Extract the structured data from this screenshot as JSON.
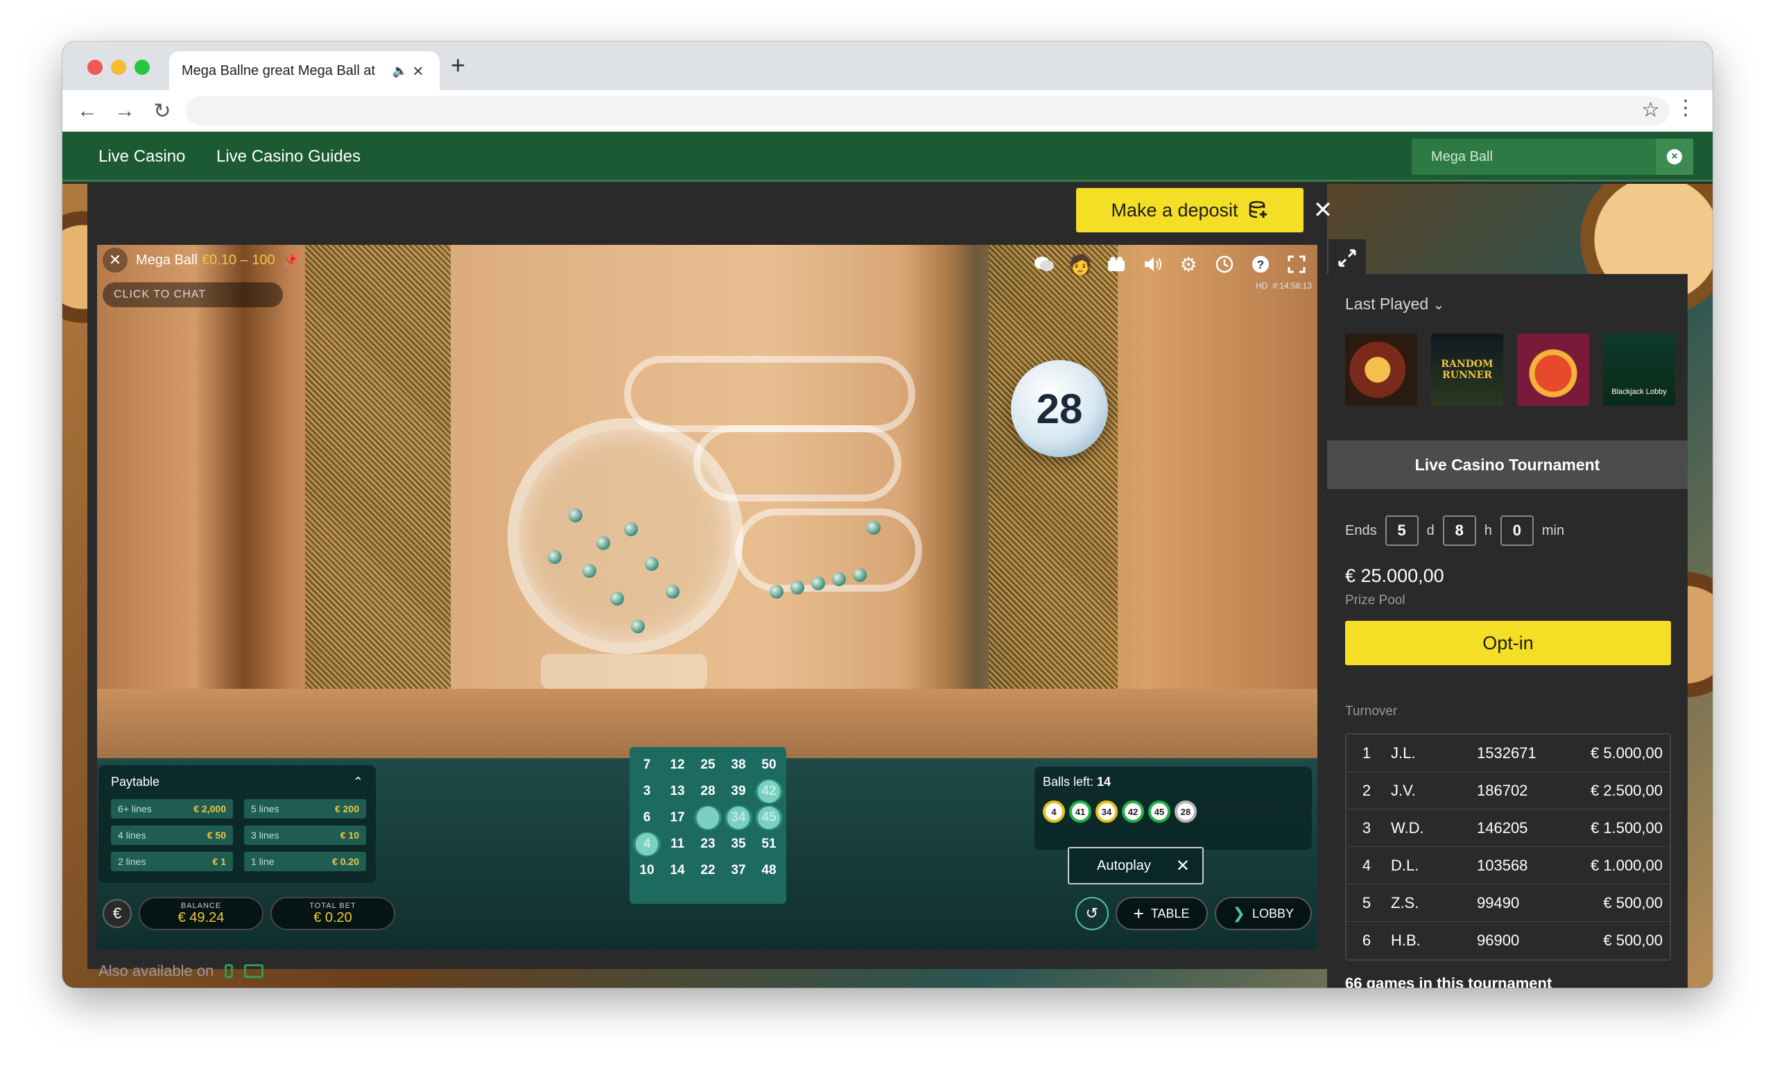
{
  "browser": {
    "tab_title": "Mega Ball​​ - The great Mega Ball at",
    "tab_display": "Mega Ballne great Mega Ball at",
    "new_tab_label": "+"
  },
  "site_nav": {
    "links": [
      "Live Casino",
      "Live Casino Guides"
    ],
    "search_value": "Mega Ball"
  },
  "deposit": {
    "label": "Make a deposit"
  },
  "game": {
    "title": "Mega Ball",
    "limits": "€0.10 – 100",
    "chat_label": "CLICK TO CHAT",
    "quality": "HD",
    "stream_id": "#:14:58:13",
    "big_ball": "28",
    "paytable": {
      "title": "Paytable",
      "rows": [
        {
          "label": "6+ lines",
          "value": "€ 2,000"
        },
        {
          "label": "5 lines",
          "value": "€ 200"
        },
        {
          "label": "4 lines",
          "value": "€ 50"
        },
        {
          "label": "3 lines",
          "value": "€ 10"
        },
        {
          "label": "2 lines",
          "value": "€ 1"
        },
        {
          "label": "1 line",
          "value": "€ 0.20"
        }
      ]
    },
    "balance_label": "BALANCE",
    "balance_value": "€ 49.24",
    "total_bet_label": "TOTAL BET",
    "total_bet_value": "€ 0.20",
    "card": [
      "7",
      "12",
      "25",
      "38",
      "50",
      "3",
      "13",
      "28",
      "39",
      "42",
      "6",
      "17",
      "",
      "34",
      "45",
      "4",
      "11",
      "23",
      "35",
      "51",
      "10",
      "14",
      "22",
      "37",
      "48"
    ],
    "card_hits": [
      "42",
      "34",
      "45",
      "4",
      ""
    ],
    "balls_left_label": "Balls left:",
    "balls_left_value": "14",
    "drawn_balls": [
      {
        "n": "4",
        "c": "y"
      },
      {
        "n": "41",
        "c": "g"
      },
      {
        "n": "34",
        "c": "y"
      },
      {
        "n": "42",
        "c": "g"
      },
      {
        "n": "45",
        "c": "g"
      },
      {
        "n": "28",
        "c": "w"
      }
    ],
    "autoplay_label": "Autoplay",
    "table_label": "TABLE",
    "lobby_label": "LOBBY"
  },
  "also_available": "Also available on",
  "sidebar": {
    "last_played": "Last Played",
    "thumbs": [
      "Lightning Roulette",
      "Random Runner Deluxe",
      "Crazy Time",
      "Blackjack Lobby"
    ],
    "thumb_texts": [
      "",
      "RANDOM RUNNER",
      "",
      "Blackjack Lobby"
    ],
    "tournament_title": "Live Casino Tournament",
    "ends_label": "Ends",
    "days": "5",
    "d_label": "d",
    "hours": "8",
    "h_label": "h",
    "mins": "0",
    "min_label": "min",
    "prize": "€ 25.000,00",
    "prize_label": "Prize Pool",
    "optin": "Opt-in",
    "turnover_label": "Turnover",
    "leaderboard": [
      {
        "rank": "1",
        "name": "J.L.",
        "score": "1532671",
        "prize": "€ 5.000,00"
      },
      {
        "rank": "2",
        "name": "J.V.",
        "score": "186702",
        "prize": "€ 2.500,00"
      },
      {
        "rank": "3",
        "name": "W.D.",
        "score": "146205",
        "prize": "€ 1.500,00"
      },
      {
        "rank": "4",
        "name": "D.L.",
        "score": "103568",
        "prize": "€ 1.000,00"
      },
      {
        "rank": "5",
        "name": "Z.S.",
        "score": "99490",
        "prize": "€ 500,00"
      },
      {
        "rank": "6",
        "name": "H.B.",
        "score": "96900",
        "prize": "€ 500,00"
      }
    ],
    "games_count": "66 games in this tournament"
  },
  "colors": {
    "nav_green": "#1b5a32",
    "accent_yellow": "#f5de26",
    "panel_dark": "#2a2a2a"
  }
}
